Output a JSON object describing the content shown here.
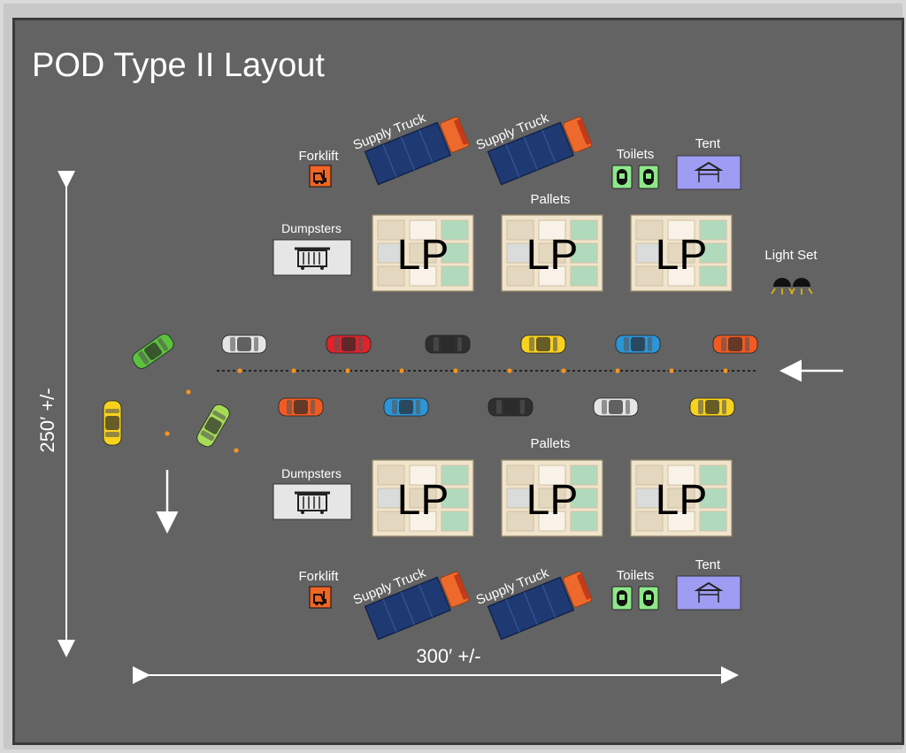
{
  "title": "POD Type II Layout",
  "dimensions": {
    "height": "250′ +/-",
    "width": "300′ +/-"
  },
  "labels": {
    "forklift": "Forklift",
    "supply_truck": "Supply Truck",
    "toilets": "Toilets",
    "tent": "Tent",
    "pallets": "Pallets",
    "dumpsters": "Dumpsters",
    "light_set": "Light Set",
    "pallet_mark": "LP"
  },
  "colors": {
    "background": "#636363",
    "truck_cab": "#ee6a2c",
    "truck_trailer": "#1f3a73",
    "forklift_sign": "#f26522",
    "toilet_sign": "#8ee88a",
    "tent_box": "#9f9cf3",
    "dumpster_box": "#e6e6e6",
    "pallet_box": "#f1e4cc",
    "cone": "#f7941d"
  },
  "icons": [
    "forklift-icon",
    "toilet-icon",
    "tent-icon",
    "dumpster-icon",
    "light-set-icon",
    "car-icon",
    "arrow-icon"
  ],
  "vehicles": {
    "upper_lane": [
      "#5bc23b",
      "#e5e5e5",
      "#e0222b",
      "#2f2f2f",
      "#f8d21d",
      "#2c95d6",
      "#f25a22"
    ],
    "lower_lane": [
      "#f25a22",
      "#2c95d6",
      "#2f2f2f",
      "#e5e5e5",
      "#f8d21d"
    ],
    "turning": [
      "#f8d21d",
      "#a6db55"
    ]
  }
}
